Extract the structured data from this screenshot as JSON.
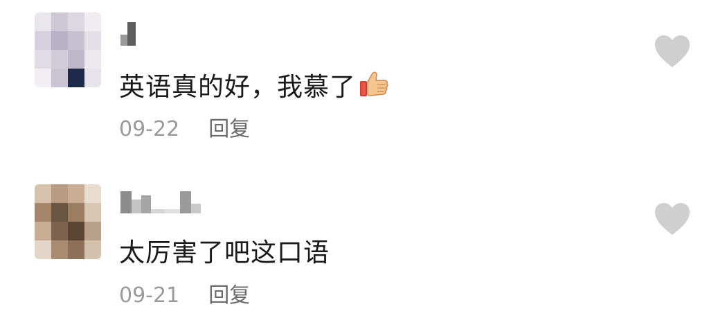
{
  "comments": [
    {
      "content": "英语真的好，我慕了",
      "emoji": "thumbs-up-icon",
      "timestamp": "09-22",
      "reply_label": "回复",
      "like_icon": "heart-icon"
    },
    {
      "content": "太厉害了吧这口语",
      "timestamp": "09-21",
      "reply_label": "回复",
      "like_icon": "heart-icon"
    }
  ],
  "colors": {
    "text": "#1a1a1a",
    "meta": "#9a9a9a",
    "reply": "#6b6b6b",
    "heart": "#cfcfcf"
  }
}
